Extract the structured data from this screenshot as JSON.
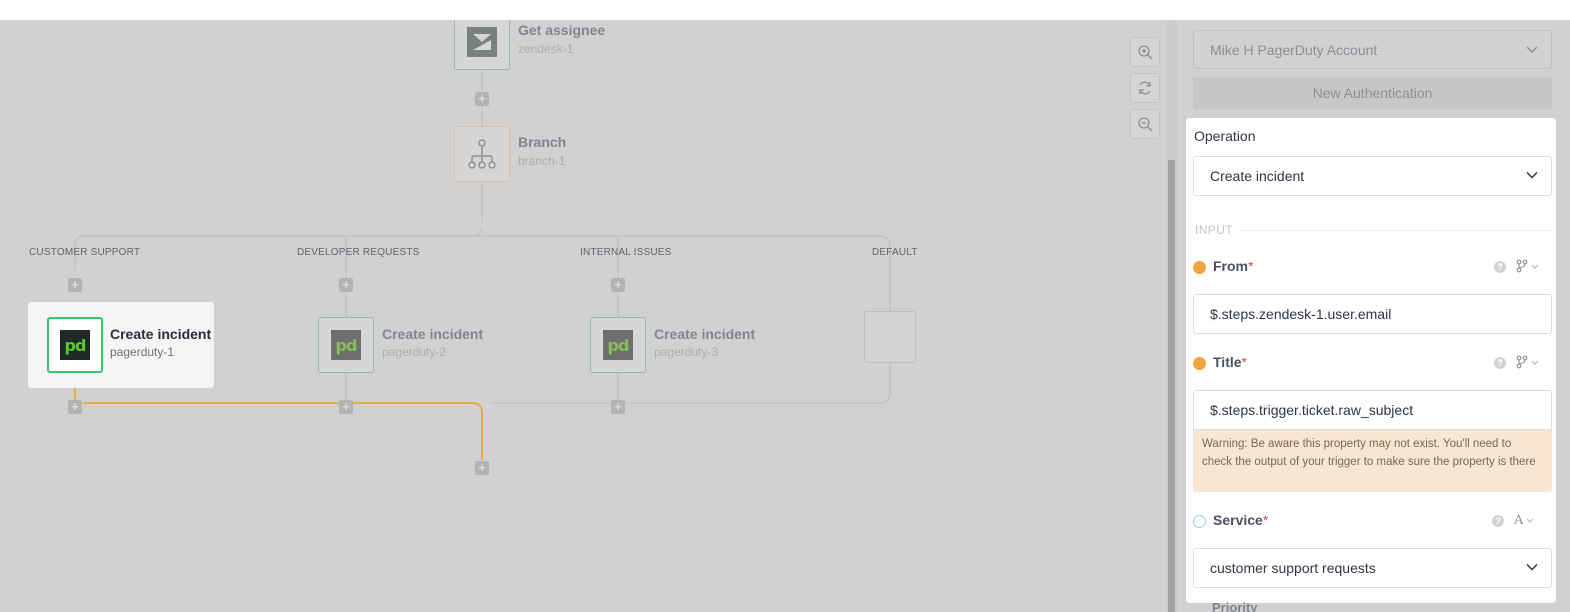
{
  "flow": {
    "nodes": {
      "zendesk": {
        "title": "Get assignee",
        "subtitle": "zendesk-1"
      },
      "branch": {
        "title": "Branch",
        "subtitle": "branch-1"
      },
      "pd1": {
        "title": "Create incident",
        "subtitle": "pagerduty-1",
        "logo": "pd"
      },
      "pd2": {
        "title": "Create incident",
        "subtitle": "pagerduty-2",
        "logo": "pd"
      },
      "pd3": {
        "title": "Create incident",
        "subtitle": "pagerduty-3",
        "logo": "pd"
      }
    },
    "branches": [
      "CUSTOMER SUPPORT",
      "DEVELOPER REQUESTS",
      "INTERNAL ISSUES",
      "DEFAULT"
    ],
    "add_step_symbol": "+",
    "highlight_color": "#e8ad3e"
  },
  "zoom": {
    "zoom_in_icon": "zoom-in-icon",
    "reset_icon": "refresh-icon",
    "zoom_out_icon": "zoom-out-icon"
  },
  "panel": {
    "account_select": {
      "value": "Mike H PagerDuty Account"
    },
    "new_auth_button": "New Authentication",
    "operation": {
      "label": "Operation",
      "value": "Create incident"
    },
    "input_section": "INPUT",
    "fields": {
      "from": {
        "label": "From",
        "required_mark": "*",
        "value": "$.steps.zendesk-1.user.email",
        "help": "?",
        "mode_icon": "branch-icon"
      },
      "title": {
        "label": "Title",
        "required_mark": "*",
        "value": "$.steps.trigger.ticket.raw_subject",
        "help": "?",
        "mode_icon": "branch-icon",
        "warning": "Warning: Be aware this property may not exist. You'll need to check the output of your trigger to make sure the property is there"
      },
      "service": {
        "label": "Service",
        "required_mark": "*",
        "value": "customer support requests",
        "help": "?",
        "mode_label": "A"
      }
    },
    "next_field_partial": "Priority"
  },
  "colors": {
    "accent_orange": "#f4a23b",
    "required_red": "#e04545",
    "pagerduty_green": "#3cc46e"
  }
}
